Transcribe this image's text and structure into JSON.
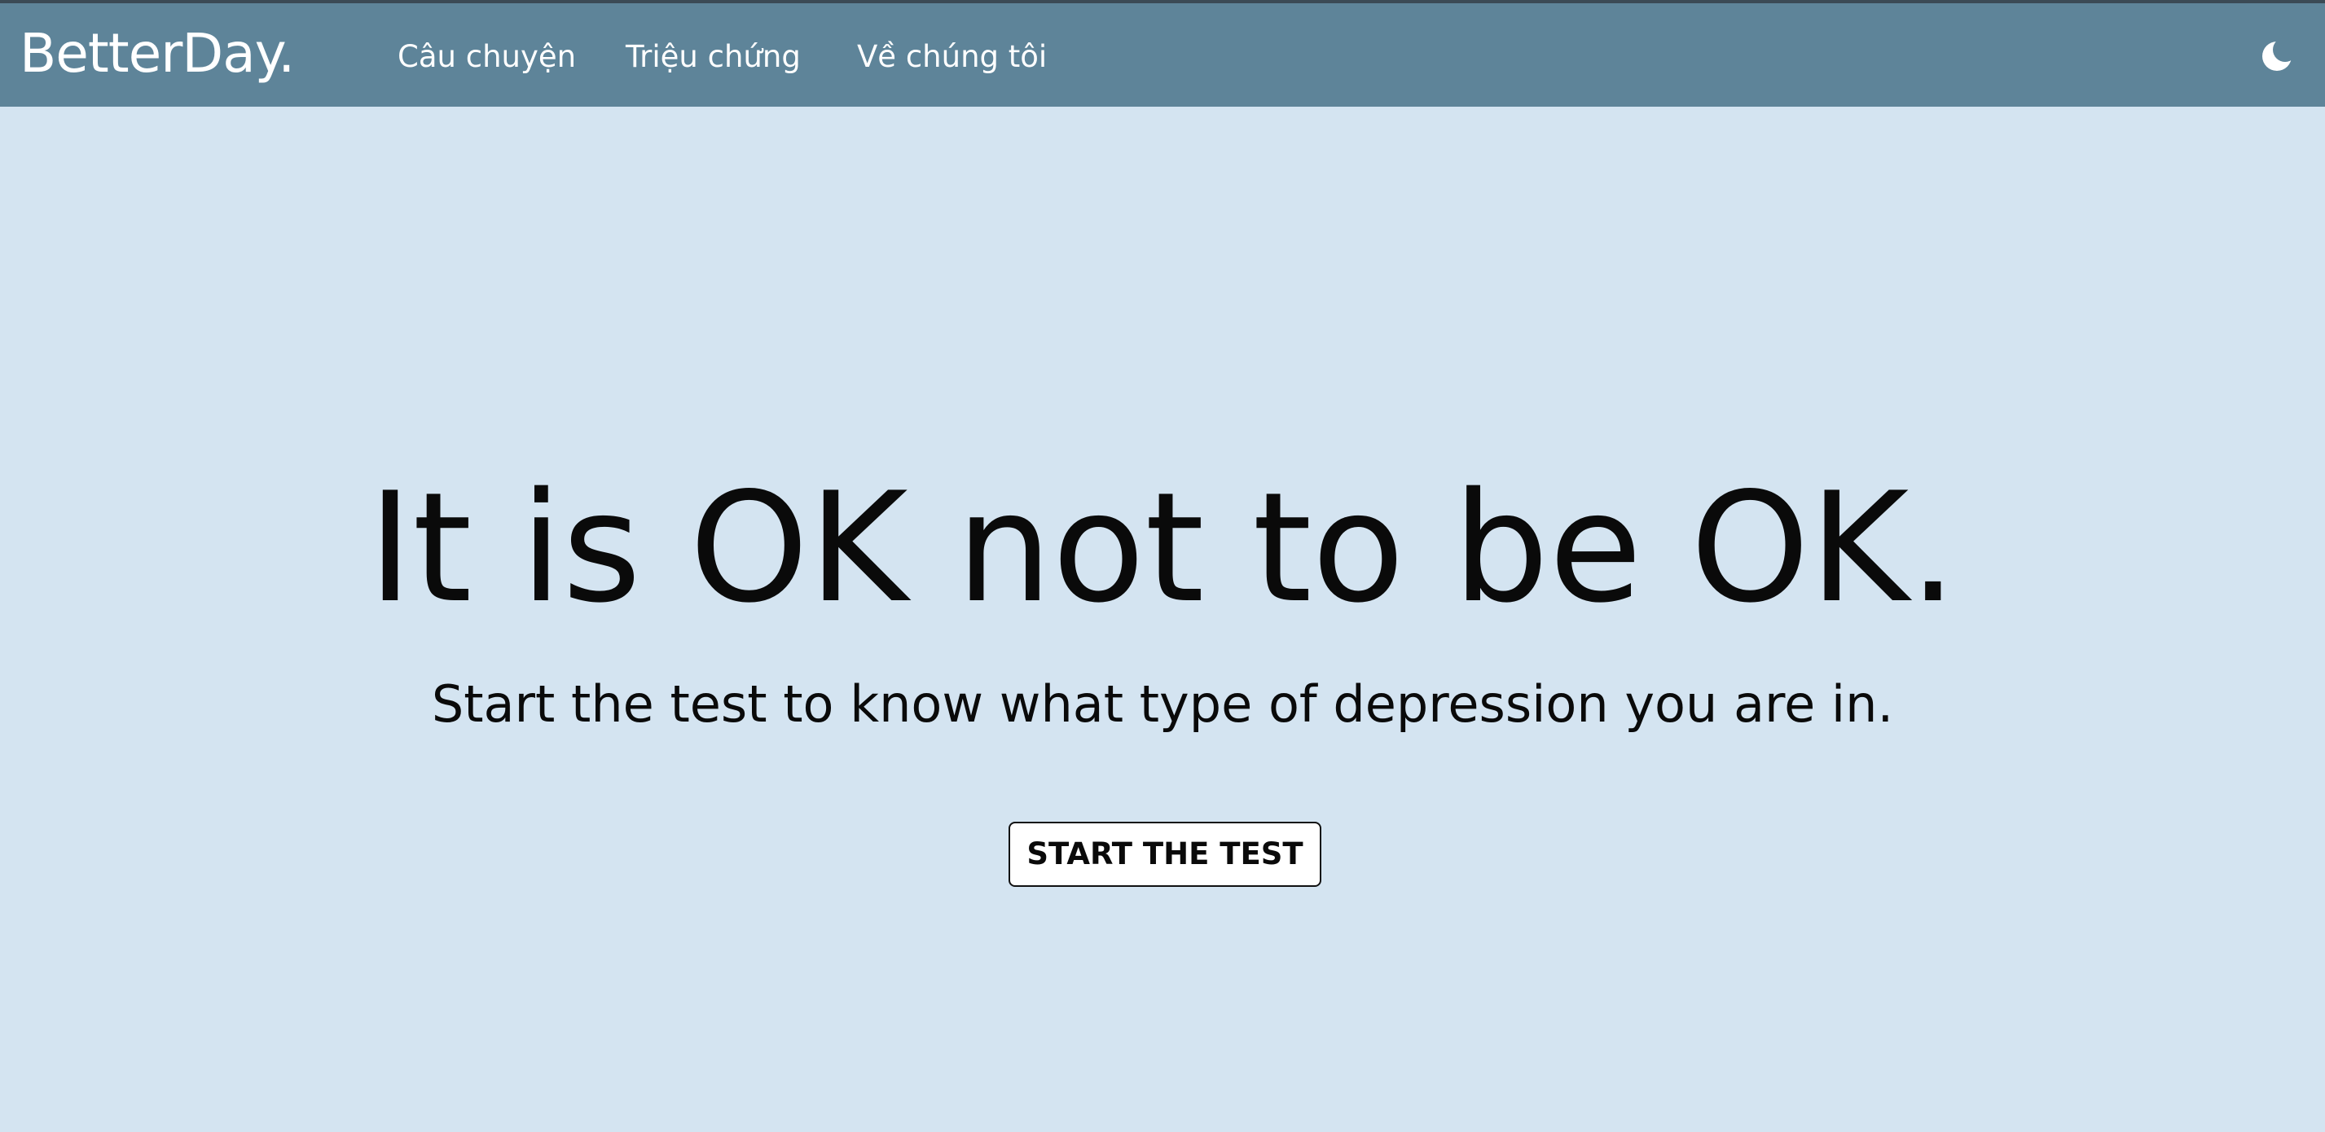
{
  "header": {
    "brand": "BetterDay.",
    "nav": [
      {
        "label": "Câu chuyện"
      },
      {
        "label": "Triệu chứng"
      },
      {
        "label": "Về chúng tôi"
      }
    ],
    "theme_toggle_icon": "moon-icon",
    "background_color": "#5e8499"
  },
  "hero": {
    "title": "It is OK not to be OK.",
    "subtitle": "Start the test to know what type of depression you are in.",
    "cta_label": "START THE TEST",
    "background_color": "#d4e4f1"
  }
}
